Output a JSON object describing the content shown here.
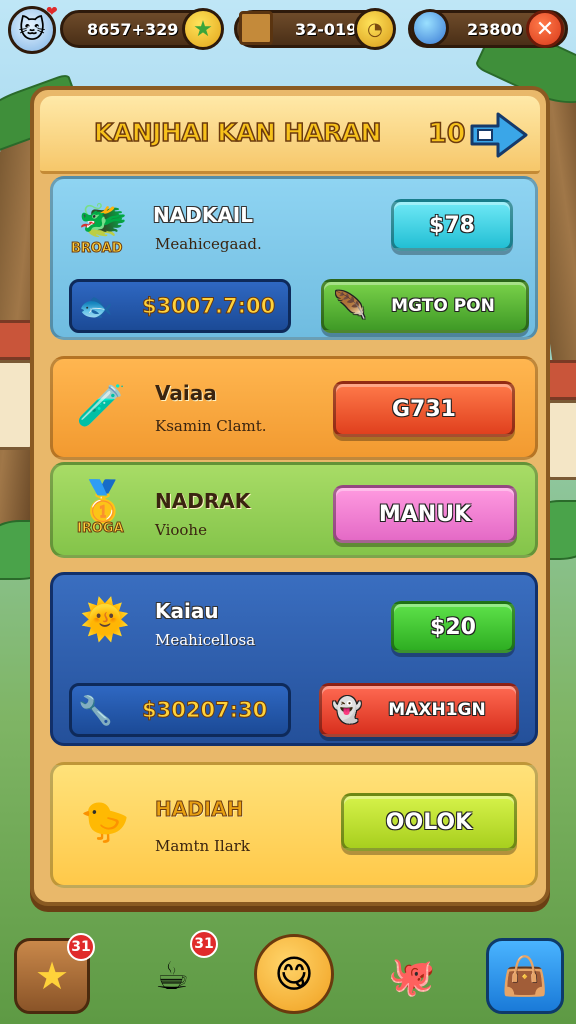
{
  "topbar": {
    "avatar_icon": "cat-avatar-icon",
    "resource_1": {
      "value": "8657+329",
      "icon": "star-add-icon"
    },
    "resource_2": {
      "value": "32-019",
      "icon": "coin-icon"
    },
    "resource_3": {
      "value": "23800",
      "icon": "gem-icon"
    },
    "close_label": "✕"
  },
  "panel": {
    "title": "KANJHAI KAN HARAN",
    "count": "10"
  },
  "cards": [
    {
      "title": "NADKAIL",
      "subtitle": "Meahicegaad.",
      "tag": "BROAD",
      "button": "$78",
      "price": "$3007.7:00",
      "action": "MGTO PON",
      "colors": {
        "bg": "#7fc8ea",
        "button": "#3fd6e6",
        "action": "#5bb53a"
      }
    },
    {
      "title": "Vaiaa",
      "subtitle": "Ksamin Clamt.",
      "button": "G731",
      "colors": {
        "bg": "#f6a440",
        "button": "#ef5a2e"
      }
    },
    {
      "title": "NADRAK",
      "subtitle": "Vioohe",
      "tag": "IROGA",
      "button": "MANUK",
      "colors": {
        "bg": "#9ad45a",
        "button": "#f07bd0"
      }
    },
    {
      "title": "Kaiau",
      "subtitle": "Meahicellosa",
      "button": "$20",
      "price": "$30207:30",
      "action": "MAXH1GN",
      "colors": {
        "bg": "#2f5db0",
        "button": "#3fcf3a",
        "action": "#e83c2e"
      }
    },
    {
      "title": "HADIAH",
      "subtitle": "Mamtn Ilark",
      "button": "OOLOK",
      "colors": {
        "bg": "#ffd45a",
        "button": "#b8e432"
      }
    }
  ],
  "nav": {
    "star_badge": "31",
    "cup_badge": "31"
  }
}
